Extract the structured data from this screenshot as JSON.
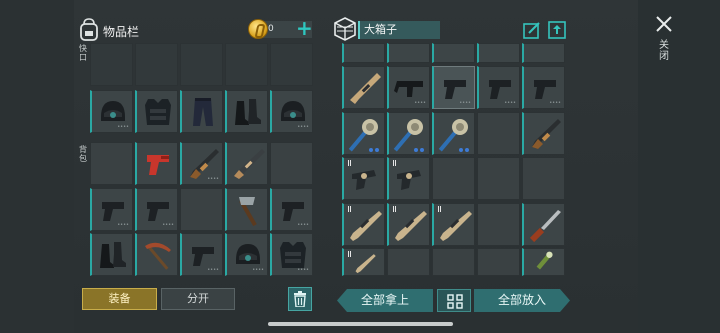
{
  "inventory": {
    "title": "物品栏",
    "coins": "0",
    "add_label": "+",
    "quick_label": "快口",
    "backpack_label": "背包"
  },
  "container": {
    "name": "大箱子"
  },
  "close_label": "关闭",
  "buttons": {
    "equip": "装备",
    "split": "分开",
    "take_all": "全部拿上",
    "sort": "B",
    "put_all": "全部放入"
  },
  "colors": {
    "accent": "#2aa9a4",
    "equip_button": "#8a7428",
    "action_button": "#2f6e70"
  }
}
